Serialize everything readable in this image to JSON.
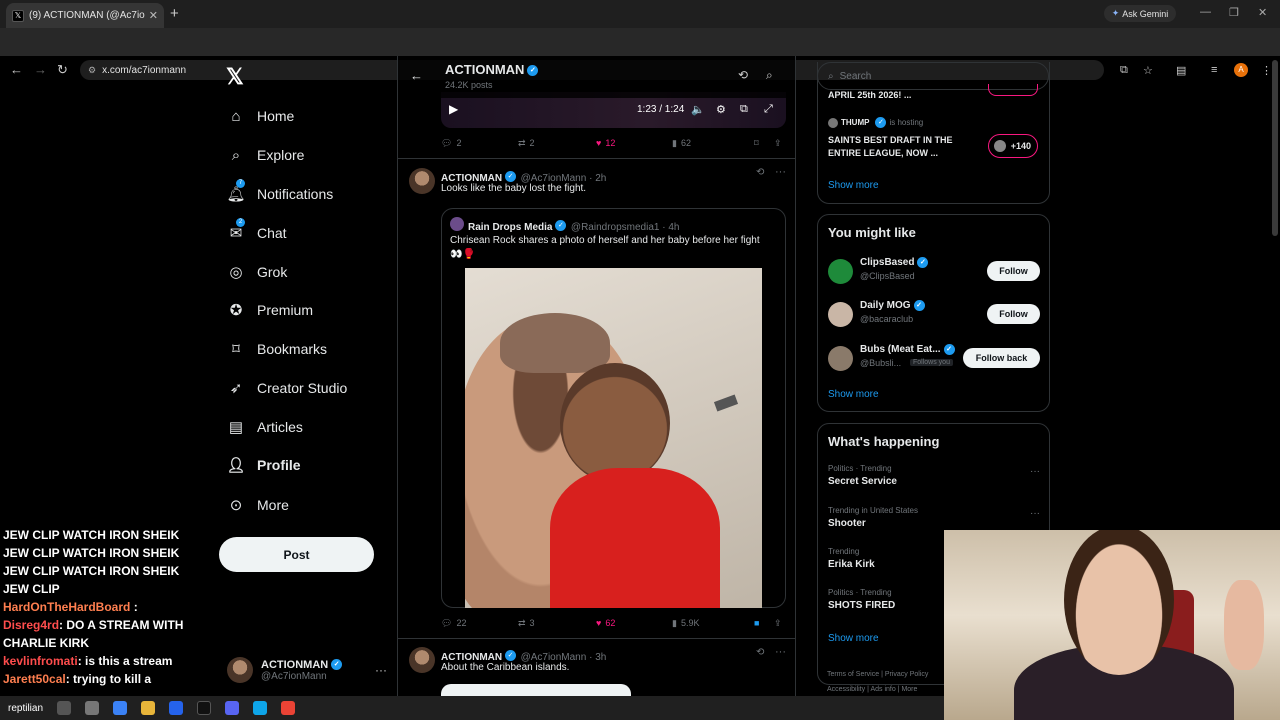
{
  "browser": {
    "tab_title": "(9) ACTIONMAN (@Ac7ionMan",
    "tab_icon": "x-logo-icon",
    "url": "x.com/ac7ionmann",
    "ask_gemini": "Ask Gemini",
    "profile_initial": "A"
  },
  "nav": {
    "items": [
      {
        "label": "Home",
        "icon": "home-icon"
      },
      {
        "label": "Explore",
        "icon": "search-icon"
      },
      {
        "label": "Notifications",
        "icon": "bell-icon",
        "badge": "7"
      },
      {
        "label": "Chat",
        "icon": "chat-icon",
        "badge": "2"
      },
      {
        "label": "Grok",
        "icon": "grok-icon"
      },
      {
        "label": "Premium",
        "icon": "premium-icon"
      },
      {
        "label": "Bookmarks",
        "icon": "bookmark-icon"
      },
      {
        "label": "Creator Studio",
        "icon": "rocket-icon"
      },
      {
        "label": "Articles",
        "icon": "articles-icon"
      },
      {
        "label": "Profile",
        "icon": "person-icon"
      },
      {
        "label": "More",
        "icon": "more-icon"
      }
    ],
    "post_label": "Post",
    "account": {
      "name": "ACTIONMAN",
      "handle": "@Ac7ionMann"
    }
  },
  "header": {
    "name": "ACTIONMAN",
    "post_count": "24.2K posts"
  },
  "video": {
    "time": "1:23 / 1:24"
  },
  "tweet0_actions": {
    "replies": "2",
    "reposts": "2",
    "likes": "12",
    "views": "62"
  },
  "tweet1": {
    "name": "ACTIONMAN",
    "meta": "@Ac7ionMann · 2h",
    "text": "Looks like the baby lost the fight.",
    "quote": {
      "name": "Rain Drops Media",
      "meta": "@Raindropsmedia1 · 4h",
      "text": "Chrisean Rock shares a photo of herself and her baby before her fight",
      "emoji": "👀🥊"
    },
    "actions": {
      "replies": "22",
      "reposts": "3",
      "likes": "62",
      "views": "5.9K"
    }
  },
  "tweet2": {
    "name": "ACTIONMAN",
    "meta": "@Ac7ionMann · 3h",
    "text": "About the Caribbean islands."
  },
  "right": {
    "search_placeholder": "Search",
    "spaces": {
      "prev_title": "APRIL 25th 2026! ...",
      "host": "THUMP",
      "hosting": "is hosting",
      "title": "SAINTS BEST DRAFT IN THE ENTIRE LEAGUE, NOW ...",
      "listeners": "+140",
      "show_more": "Show more"
    },
    "you_might_like": {
      "title": "You might like",
      "users": [
        {
          "name": "ClipsBased",
          "handle": "@ClipsBased",
          "button": "Follow"
        },
        {
          "name": "Daily MOG",
          "handle": "@bacaraclub",
          "button": "Follow"
        },
        {
          "name": "Bubs (Meat Eat...",
          "handle": "@Bubsli...",
          "follows_you": "Follows you",
          "button": "Follow back"
        }
      ],
      "show_more": "Show more"
    },
    "whats_happening": {
      "title": "What's happening",
      "trends": [
        {
          "context": "Politics · Trending",
          "topic": "Secret Service"
        },
        {
          "context": "Trending in United States",
          "topic": "Shooter"
        },
        {
          "context": "Trending",
          "topic": "Erika Kirk"
        },
        {
          "context": "Politics · Trending",
          "topic": "SHOTS FIRED"
        }
      ],
      "show_more": "Show more"
    },
    "footer": {
      "l1": "Terms of Service  |  Privacy Policy",
      "l2": "Accessibility  |  Ads info  |  More"
    }
  },
  "chat_overlay": {
    "spam": [
      "JEW CLIP WATCH IRON SHEIK",
      "JEW CLIP WATCH IRON SHEIK",
      "JEW CLIP WATCH IRON SHEIK",
      "JEW CLIP"
    ],
    "messages": [
      {
        "user": "HardOnTheHardBoard",
        "text": ":"
      },
      {
        "user": "Disreg4rd",
        "text": ": DO A STREAM WITH CHARLIE KIRK"
      },
      {
        "user": "kevlinfromati",
        "text": ": is this a stream"
      },
      {
        "user": "Jarett50cal",
        "text": ": trying to kill a"
      }
    ],
    "taskbar_label": "reptilian"
  }
}
